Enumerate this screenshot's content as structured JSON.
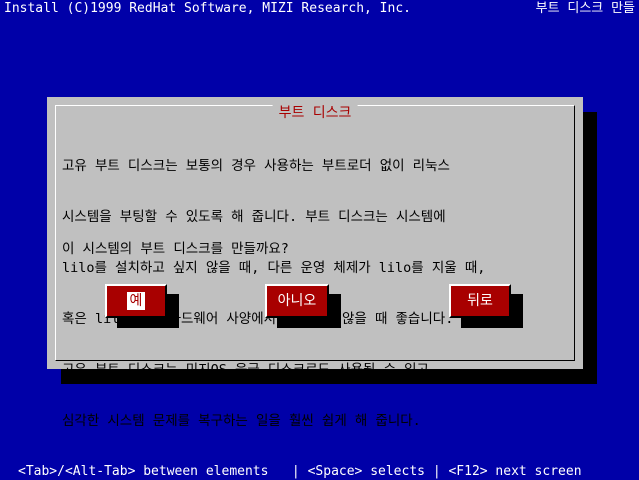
{
  "header": {
    "left_text": "Install (C)1999 RedHat Software, MIZI Research, Inc.",
    "right_text": "부트 디스크 만들"
  },
  "dialog": {
    "title": "부트 디스크",
    "body_lines": [
      "고유 부트 디스크는 보통의 경우 사용하는 부트로더 없이 리눅스",
      "시스템을 부팅할 수 있도록 해 줍니다. 부트 디스크는 시스템에",
      "lilo를 설치하고 싶지 않을 때, 다른 운영 체제가 lilo를 지울 때,",
      "혹은 lilo가 이 하드웨어 사양에서 동작하지 않을 때 좋습니다.",
      "고유 부트 디스크는 미지OS 응급 디스크로도 사용될 수 있고,",
      "심각한 시스템 문제를 복구하는 일을 훨씬 쉽게 해 줍니다."
    ],
    "question": "이 시스템의 부트 디스크를 만들까요?",
    "buttons": {
      "yes": "예",
      "no": "아니오",
      "back": "뒤로"
    }
  },
  "footer": {
    "help_text": "<Tab>/<Alt-Tab> between elements   | <Space> selects | <F12> next screen"
  },
  "colors": {
    "background": "#0000a8",
    "dialog": "#c0c0c0",
    "accent": "#a80000",
    "text": "#000000"
  }
}
